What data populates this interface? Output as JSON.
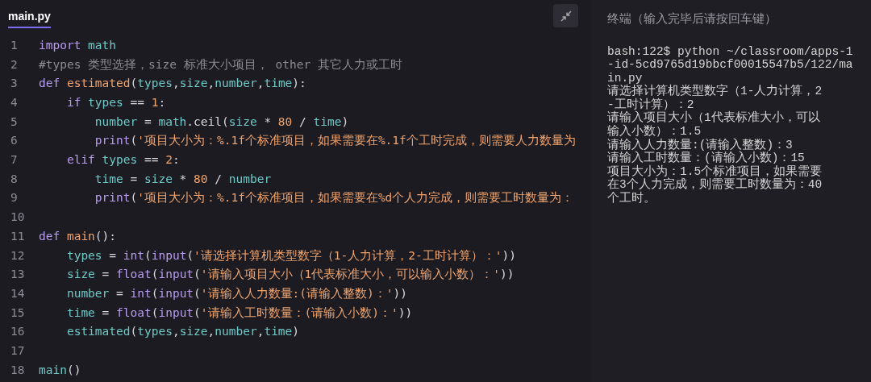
{
  "editor": {
    "tab": {
      "label": "main.py",
      "selected": true
    },
    "lines": [
      {
        "number": "1",
        "tokens": [
          {
            "kind": "kw",
            "text": "import"
          },
          {
            "kind": "var",
            "text": " math"
          }
        ]
      },
      {
        "number": "2",
        "tokens": [
          {
            "kind": "comment",
            "text": "#types 类型选择，size 标准大小项目， other 其它人力或工时"
          }
        ]
      },
      {
        "number": "3",
        "tokens": [
          {
            "kind": "kw",
            "text": "def"
          },
          {
            "kind": "fn",
            "text": " estimated"
          },
          {
            "kind": "punct",
            "text": "("
          },
          {
            "kind": "var",
            "text": "types"
          },
          {
            "kind": "punct",
            "text": ","
          },
          {
            "kind": "var",
            "text": "size"
          },
          {
            "kind": "punct",
            "text": ","
          },
          {
            "kind": "var",
            "text": "number"
          },
          {
            "kind": "punct",
            "text": ","
          },
          {
            "kind": "var",
            "text": "time"
          },
          {
            "kind": "punct",
            "text": "):"
          }
        ]
      },
      {
        "number": "4",
        "tokens": [
          {
            "kind": "kw",
            "text": "    if"
          },
          {
            "kind": "var",
            "text": " types"
          },
          {
            "kind": "punct",
            "text": " == "
          },
          {
            "kind": "num",
            "text": "1"
          },
          {
            "kind": "punct",
            "text": ":"
          }
        ]
      },
      {
        "number": "5",
        "tokens": [
          {
            "kind": "var",
            "text": "        number"
          },
          {
            "kind": "punct",
            "text": " = "
          },
          {
            "kind": "var",
            "text": "math"
          },
          {
            "kind": "punct",
            "text": ".ceil("
          },
          {
            "kind": "var",
            "text": "size"
          },
          {
            "kind": "punct",
            "text": " * "
          },
          {
            "kind": "num",
            "text": "80"
          },
          {
            "kind": "punct",
            "text": " / "
          },
          {
            "kind": "var",
            "text": "time"
          },
          {
            "kind": "punct",
            "text": ")"
          }
        ]
      },
      {
        "number": "6",
        "tokens": [
          {
            "kind": "builtin",
            "text": "        print"
          },
          {
            "kind": "punct",
            "text": "("
          },
          {
            "kind": "str",
            "text": "'项目大小为：%.1f个标准项目，如果需要在%.1f个工时完成，则需要人力数量为"
          }
        ]
      },
      {
        "number": "7",
        "tokens": [
          {
            "kind": "kw",
            "text": "    elif"
          },
          {
            "kind": "var",
            "text": " types"
          },
          {
            "kind": "punct",
            "text": " == "
          },
          {
            "kind": "num",
            "text": "2"
          },
          {
            "kind": "punct",
            "text": ":"
          }
        ]
      },
      {
        "number": "8",
        "tokens": [
          {
            "kind": "var",
            "text": "        time"
          },
          {
            "kind": "punct",
            "text": " = "
          },
          {
            "kind": "var",
            "text": "size"
          },
          {
            "kind": "punct",
            "text": " * "
          },
          {
            "kind": "num",
            "text": "80"
          },
          {
            "kind": "punct",
            "text": " / "
          },
          {
            "kind": "var",
            "text": "number"
          }
        ]
      },
      {
        "number": "9",
        "tokens": [
          {
            "kind": "builtin",
            "text": "        print"
          },
          {
            "kind": "punct",
            "text": "("
          },
          {
            "kind": "str",
            "text": "'项目大小为：%.1f个标准项目，如果需要在%d个人力完成，则需要工时数量为："
          }
        ]
      },
      {
        "number": "10"
      },
      {
        "number": "11",
        "tokens": [
          {
            "kind": "kw",
            "text": "def"
          },
          {
            "kind": "fn",
            "text": " main"
          },
          {
            "kind": "punct",
            "text": "():"
          }
        ]
      },
      {
        "number": "12",
        "tokens": [
          {
            "kind": "var",
            "text": "    types"
          },
          {
            "kind": "punct",
            "text": " = "
          },
          {
            "kind": "builtin",
            "text": "int"
          },
          {
            "kind": "punct",
            "text": "("
          },
          {
            "kind": "builtin",
            "text": "input"
          },
          {
            "kind": "punct",
            "text": "("
          },
          {
            "kind": "str",
            "text": "'请选择计算机类型数字（1-人力计算，2-工时计算）：'"
          },
          {
            "kind": "punct",
            "text": "))"
          }
        ]
      },
      {
        "number": "13",
        "tokens": [
          {
            "kind": "var",
            "text": "    size"
          },
          {
            "kind": "punct",
            "text": " = "
          },
          {
            "kind": "builtin",
            "text": "float"
          },
          {
            "kind": "punct",
            "text": "("
          },
          {
            "kind": "builtin",
            "text": "input"
          },
          {
            "kind": "punct",
            "text": "("
          },
          {
            "kind": "str",
            "text": "'请输入项目大小（1代表标准大小，可以输入小数）：'"
          },
          {
            "kind": "punct",
            "text": "))"
          }
        ]
      },
      {
        "number": "14",
        "tokens": [
          {
            "kind": "var",
            "text": "    number"
          },
          {
            "kind": "punct",
            "text": " = "
          },
          {
            "kind": "builtin",
            "text": "int"
          },
          {
            "kind": "punct",
            "text": "("
          },
          {
            "kind": "builtin",
            "text": "input"
          },
          {
            "kind": "punct",
            "text": "("
          },
          {
            "kind": "str",
            "text": "'请输入人力数量:(请输入整数)：'"
          },
          {
            "kind": "punct",
            "text": "))"
          }
        ]
      },
      {
        "number": "15",
        "tokens": [
          {
            "kind": "var",
            "text": "    time"
          },
          {
            "kind": "punct",
            "text": " = "
          },
          {
            "kind": "builtin",
            "text": "float"
          },
          {
            "kind": "punct",
            "text": "("
          },
          {
            "kind": "builtin",
            "text": "input"
          },
          {
            "kind": "punct",
            "text": "("
          },
          {
            "kind": "str",
            "text": "'请输入工时数量：(请输入小数)：'"
          },
          {
            "kind": "punct",
            "text": "))"
          }
        ]
      },
      {
        "number": "16",
        "tokens": [
          {
            "kind": "var",
            "text": "    estimated"
          },
          {
            "kind": "punct",
            "text": "("
          },
          {
            "kind": "var",
            "text": "types"
          },
          {
            "kind": "punct",
            "text": ","
          },
          {
            "kind": "var",
            "text": "size"
          },
          {
            "kind": "punct",
            "text": ","
          },
          {
            "kind": "var",
            "text": "number"
          },
          {
            "kind": "punct",
            "text": ","
          },
          {
            "kind": "var",
            "text": "time"
          },
          {
            "kind": "punct",
            "text": ")"
          }
        ]
      },
      {
        "number": "17"
      },
      {
        "number": "18",
        "tokens": [
          {
            "kind": "var",
            "text": "main"
          },
          {
            "kind": "punct",
            "text": "()"
          }
        ]
      }
    ]
  },
  "terminal": {
    "title": "终端（输入完毕后请按回车键）",
    "lines": [
      "bash:122$ python ~/classroom/apps-1",
      "-id-5cd9765d19bbcf00015547b5/122/ma",
      "in.py",
      "请选择计算机类型数字（1-人力计算，2",
      "-工时计算）：2",
      "请输入项目大小（1代表标准大小，可以",
      "输入小数）：1.5",
      "请输入人力数量:(请输入整数)：3",
      "请输入工时数量：(请输入小数)：15",
      "项目大小为：1.5个标准项目，如果需要",
      "在3个人力完成，则需要工时数量为：40",
      "个工时。"
    ]
  }
}
